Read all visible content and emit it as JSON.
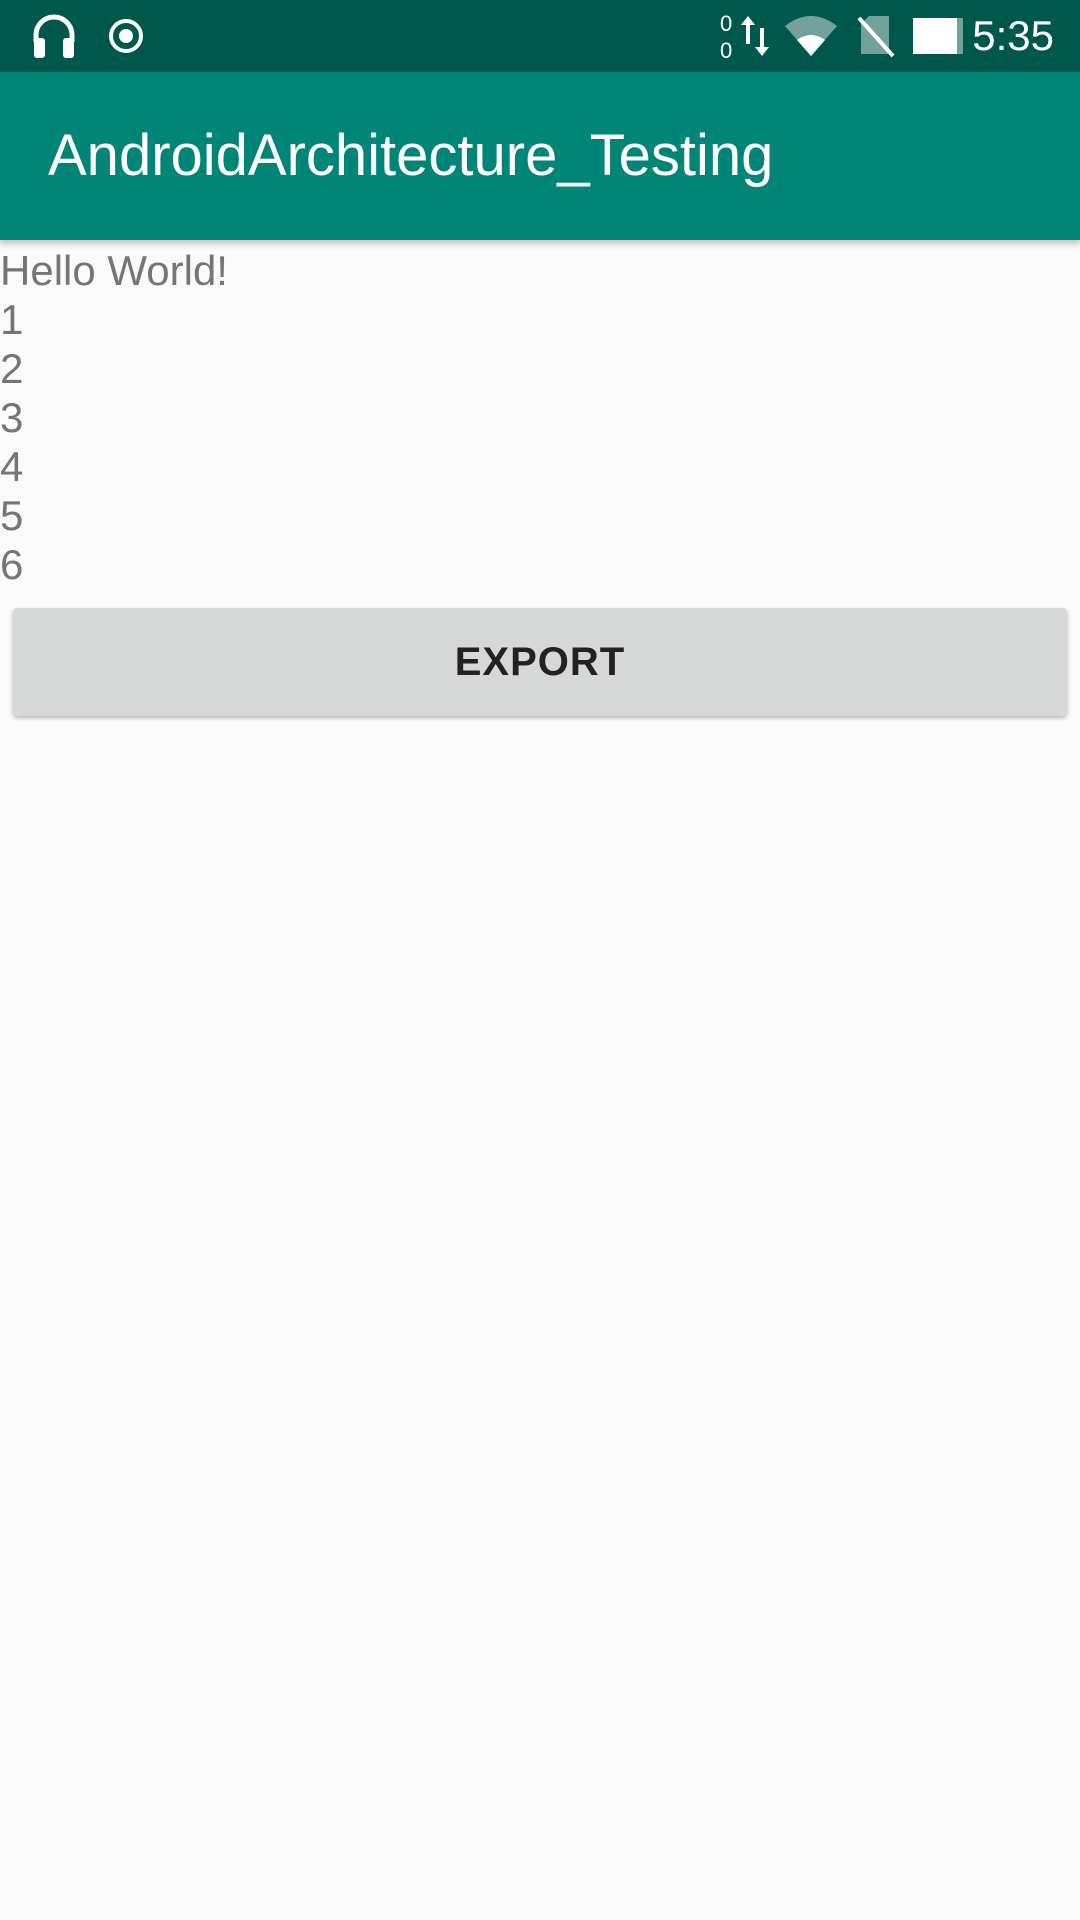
{
  "status_bar": {
    "time": "5:35",
    "data_up_count": "0",
    "data_down_count": "0",
    "icons": [
      "headphones-icon",
      "location-target-icon",
      "data-transfer-icon",
      "wifi-icon",
      "no-sim-icon",
      "battery-icon"
    ]
  },
  "app_bar": {
    "title": "AndroidArchitecture_Testing"
  },
  "content": {
    "lines": [
      "Hello World!",
      "1",
      "2",
      "3",
      "4",
      "5",
      "6"
    ]
  },
  "export_button": {
    "label": "EXPORT"
  },
  "colors": {
    "status_bar": "#00574b",
    "app_bar": "#008577",
    "background": "#fafafa",
    "text": "#757575",
    "button": "#d6d7d7"
  }
}
